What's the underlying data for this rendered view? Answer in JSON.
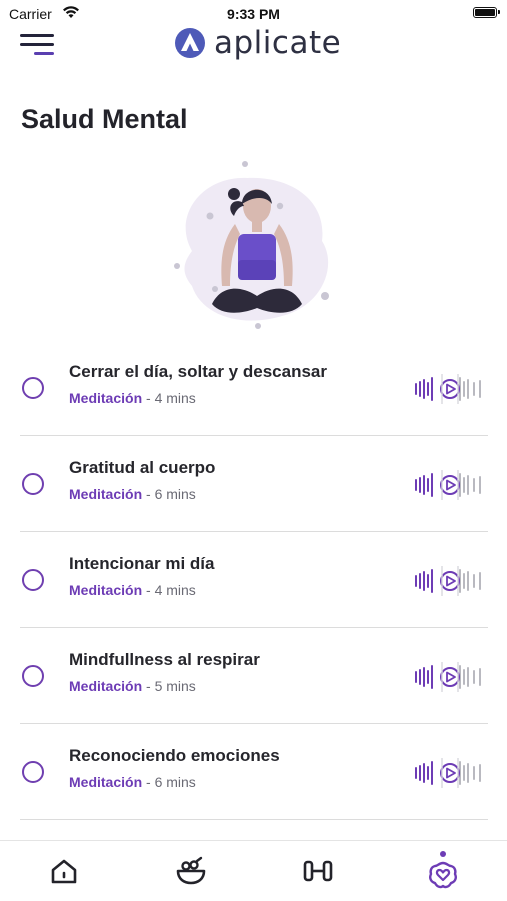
{
  "status": {
    "carrier": "Carrier",
    "time": "9:33 PM"
  },
  "header": {
    "logo_text": "aplicate",
    "menu_icon": "hamburger-menu-icon"
  },
  "page": {
    "title": "Salud Mental"
  },
  "colors": {
    "accent": "#6d3cb5",
    "text": "#23232a",
    "muted": "#6a6a74",
    "divider": "#dcdcdc"
  },
  "sessions": [
    {
      "title": "Cerrar el día, soltar y descansar",
      "type": "Meditación",
      "duration": " - 4 mins"
    },
    {
      "title": "Gratitud al cuerpo",
      "type": "Meditación",
      "duration": " - 6 mins"
    },
    {
      "title": "Intencionar mi día",
      "type": "Meditación",
      "duration": " - 4 mins"
    },
    {
      "title": "Mindfullness al respirar",
      "type": "Meditación",
      "duration": " - 5 mins"
    },
    {
      "title": "Reconociendo emociones",
      "type": "Meditación",
      "duration": " - 6 mins"
    }
  ],
  "tabbar": {
    "tabs": [
      {
        "icon": "home-icon",
        "active": false
      },
      {
        "icon": "food-bowl-icon",
        "active": false
      },
      {
        "icon": "dumbbell-icon",
        "active": false
      },
      {
        "icon": "mental-health-heart-icon",
        "active": true
      }
    ]
  }
}
